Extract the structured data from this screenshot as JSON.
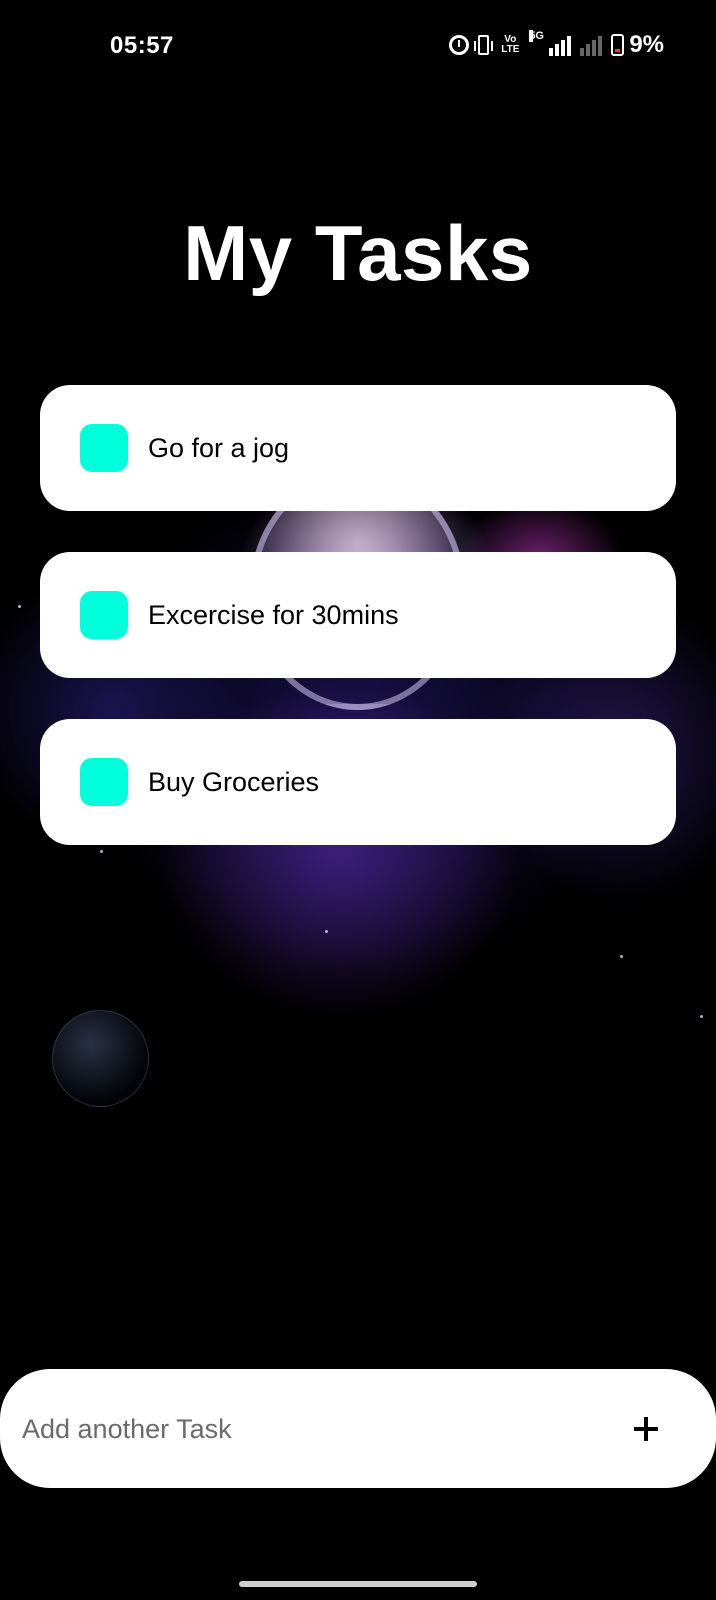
{
  "status_bar": {
    "time": "05:57",
    "network_label": "5G",
    "volte_label_top": "Vo",
    "volte_label_bottom": "LTE",
    "battery_percent": "9%",
    "icons": [
      "alarm-icon",
      "vibrate-icon",
      "volte-icon",
      "signal-5g-icon",
      "signal-icon",
      "battery-icon"
    ]
  },
  "page": {
    "title": "My Tasks"
  },
  "tasks": [
    {
      "label": "Go for a jog",
      "checkbox_color": "#00ffdd"
    },
    {
      "label": "Excercise for 30mins",
      "checkbox_color": "#00ffdd"
    },
    {
      "label": "Buy Groceries",
      "checkbox_color": "#00ffdd"
    }
  ],
  "add_task": {
    "placeholder": "Add another Task",
    "value": "",
    "button_icon": "plus-icon"
  },
  "colors": {
    "background": "#000000",
    "card": "#ffffff",
    "accent": "#00ffdd"
  }
}
